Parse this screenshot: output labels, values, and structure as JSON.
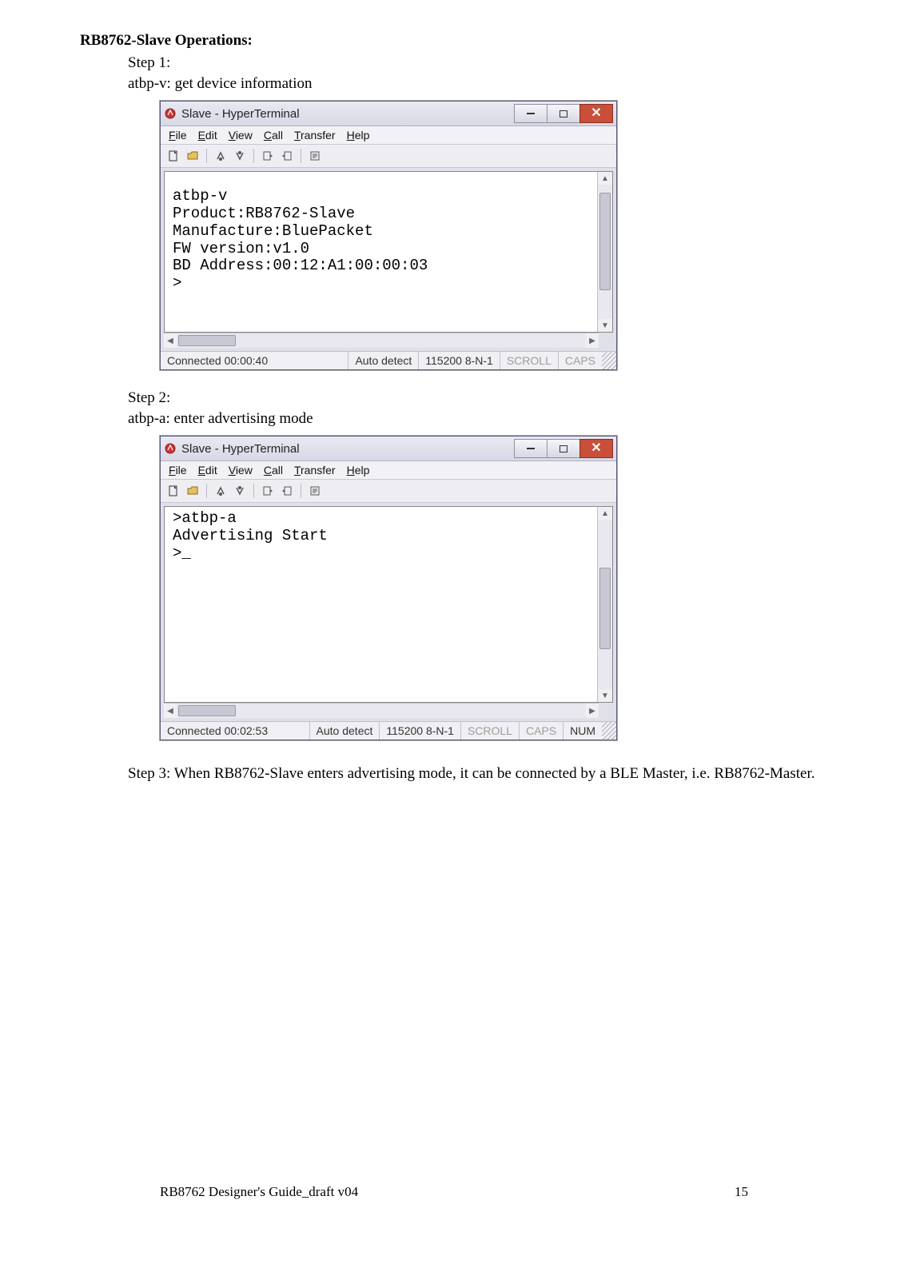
{
  "heading": "RB8762-Slave Operations:",
  "step1": {
    "label": "Step 1:",
    "desc": "atbp-v: get device information"
  },
  "step2": {
    "label": "Step 2:",
    "desc": "atbp-a: enter advertising mode"
  },
  "step3": "Step 3: When RB8762-Slave enters advertising mode, it can be connected by a BLE Master, i.e. RB8762-Master.",
  "window1": {
    "title": "Slave - HyperTerminal",
    "menu": {
      "file": "File",
      "edit": "Edit",
      "view": "View",
      "call": "Call",
      "transfer": "Transfer",
      "help": "Help"
    },
    "terminal": "atbp-v\nProduct:RB8762-Slave\nManufacture:BluePacket\nFW version:v1.0\nBD Address:00:12:A1:00:00:03\n>",
    "status": {
      "conn": "Connected 00:00:40",
      "detect": "Auto detect",
      "params": "115200 8-N-1",
      "scroll": "SCROLL",
      "caps": "CAPS"
    }
  },
  "window2": {
    "title": "Slave - HyperTerminal",
    "menu": {
      "file": "File",
      "edit": "Edit",
      "view": "View",
      "call": "Call",
      "transfer": "Transfer",
      "help": "Help"
    },
    "terminal": ">atbp-a\nAdvertising Start\n>_",
    "status": {
      "conn": "Connected 00:02:53",
      "detect": "Auto detect",
      "params": "115200 8-N-1",
      "scroll": "SCROLL",
      "caps": "CAPS",
      "num": "NUM"
    }
  },
  "footer": {
    "left": "RB8762 Designer's Guide_draft v04",
    "right": "15"
  }
}
